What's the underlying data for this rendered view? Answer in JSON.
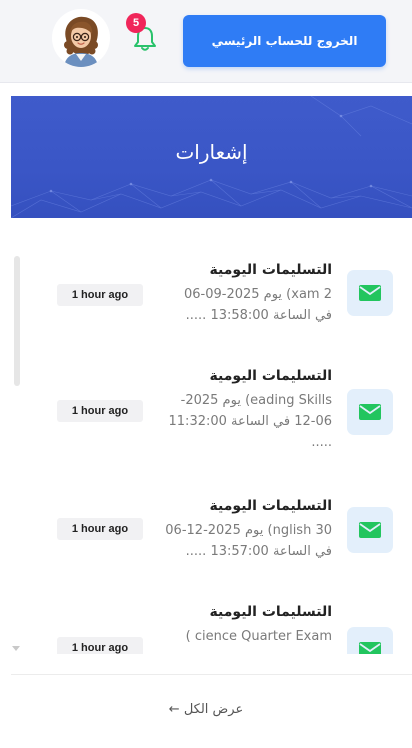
{
  "header": {
    "exit_label": "الخروج للحساب الرئيسي",
    "notification_count": "5",
    "avatar_icon": "teacher-avatar"
  },
  "banner": {
    "title": "إشعارات"
  },
  "notifications": [
    {
      "title": "التسليمات اليومية",
      "body": "xam 2) يوم 2025-09-06\nفي الساعة 13:58:00 .....",
      "time": "1 hour ago",
      "icon": "envelope-icon"
    },
    {
      "title": "التسليمات اليومية",
      "body": "eading Skills) يوم 2025-\n12-06 في الساعة 11:32:00\n.....",
      "time": "1 hour ago",
      "icon": "envelope-icon"
    },
    {
      "title": "التسليمات اليومية",
      "body": "nglish 30) يوم 2025-12-06\nفي الساعة 13:57:00 .....",
      "time": "1 hour ago",
      "icon": "envelope-icon"
    },
    {
      "title": "التسليمات اليومية",
      "body": "cience Quarter Exam )",
      "time": "1 hour ago",
      "icon": "envelope-icon"
    }
  ],
  "footer": {
    "view_all": "عرض الكل ←"
  },
  "colors": {
    "primary": "#2f7cf5",
    "banner": "#3a56c6",
    "badge": "#f0265a",
    "mail_icon": "#22c55e"
  }
}
